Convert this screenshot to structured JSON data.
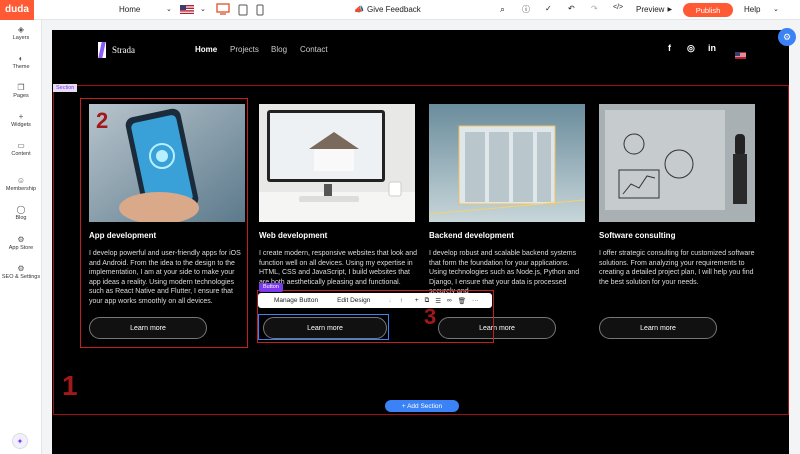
{
  "topbar": {
    "logo": "duda",
    "page_select": "Home",
    "give_feedback": "Give Feedback",
    "preview": "Preview",
    "publish": "Publish",
    "help": "Help"
  },
  "sidebar": {
    "items": [
      {
        "label": "Layers",
        "icon": "layers-icon"
      },
      {
        "label": "Theme",
        "icon": "palette-icon"
      },
      {
        "label": "Pages",
        "icon": "pages-icon"
      },
      {
        "label": "Widgets",
        "icon": "plus-icon"
      },
      {
        "label": "Content",
        "icon": "folder-icon"
      },
      {
        "label": "Membership",
        "icon": "user-icon"
      },
      {
        "label": "Blog",
        "icon": "comment-icon"
      },
      {
        "label": "App Store",
        "icon": "app-store-icon"
      },
      {
        "label": "SEO & Settings",
        "icon": "settings-icon"
      }
    ]
  },
  "site": {
    "logo_text": "Strada",
    "nav": [
      "Home",
      "Projects",
      "Blog",
      "Contact"
    ],
    "section_tag": "Section",
    "button_tag": "Button",
    "cards": [
      {
        "title": "App development",
        "desc": "I develop powerful and user-friendly apps for iOS and Android. From the idea to the design to the implementation, I am at your side to make your app ideas a reality. Using modern technologies such as React Native and Flutter, I ensure that your app works smoothly on all devices.",
        "button": "Learn more"
      },
      {
        "title": "Web development",
        "desc": "I create modern, responsive websites that look and function well on all devices. Using my expertise in HTML, CSS and JavaScript, I build websites that are both aesthetically pleasing and functional.",
        "button": "Learn more"
      },
      {
        "title": "Backend development",
        "desc": "I develop robust and scalable backend systems that form the foundation for your applications. Using technologies such as Node.js, Python and Django, I ensure that your data is processed securely and",
        "button": "Learn more"
      },
      {
        "title": "Software consulting",
        "desc": "I offer strategic consulting for customized software solutions. From analyzing your requirements to creating a detailed project plan, I will help you find the best solution for your needs.",
        "button": "Learn more"
      }
    ]
  },
  "toolbar": {
    "manage_button": "Manage Button",
    "edit_design": "Edit Design"
  },
  "add_section": "+ Add Section",
  "annotations": [
    "1",
    "2",
    "3"
  ]
}
